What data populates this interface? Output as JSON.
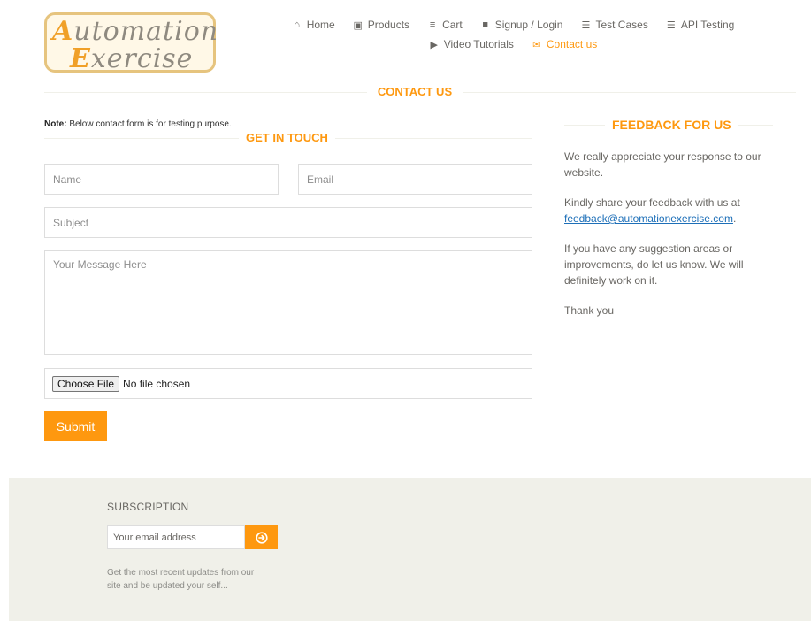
{
  "logo": {
    "line1_cap": "A",
    "line1_rest": "utomation",
    "line2_cap": "E",
    "line2_rest": "xercise"
  },
  "nav": {
    "row1": [
      {
        "icon": "home-icon",
        "glyph": "⌂",
        "label": "Home"
      },
      {
        "icon": "briefcase-icon",
        "glyph": "▣",
        "label": "Products"
      },
      {
        "icon": "cart-icon",
        "glyph": "≡",
        "label": "Cart"
      },
      {
        "icon": "lock-icon",
        "glyph": "■",
        "label": "Signup / Login"
      },
      {
        "icon": "list-icon",
        "glyph": "☰",
        "label": "Test Cases"
      },
      {
        "icon": "list-icon",
        "glyph": "☰",
        "label": "API Testing"
      }
    ],
    "row2": [
      {
        "icon": "video-icon",
        "glyph": "▶",
        "label": "Video Tutorials"
      },
      {
        "icon": "envelope-icon",
        "glyph": "✉",
        "label": "Contact us"
      }
    ]
  },
  "page": {
    "title": "CONTACT US"
  },
  "form": {
    "note_bold": "Note:",
    "note_text": " Below contact form is for testing purpose.",
    "title": "GET IN TOUCH",
    "name_placeholder": "Name",
    "email_placeholder": "Email",
    "subject_placeholder": "Subject",
    "message_placeholder": "Your Message Here",
    "file_button": "Choose File",
    "file_status": "No file chosen",
    "submit_label": "Submit"
  },
  "feedback": {
    "title": "FEEDBACK FOR US",
    "p1": "We really appreciate your response to our website.",
    "p2_text": "Kindly share your feedback with us at ",
    "p2_link": "feedback@automationexercise.com",
    "p2_end": ".",
    "p3": "If you have any suggestion areas or improvements, do let us know. We will definitely work on it.",
    "p4": "Thank you"
  },
  "footer": {
    "subscription_title": "SUBSCRIPTION",
    "email_placeholder": "Your email address",
    "subscribe_icon": "arrow-circle-right-icon",
    "note": "Get the most recent updates from our site and be updated your self..."
  },
  "colors": {
    "accent": "#fe980f",
    "footer_bg": "#f0f0e9",
    "link": "#1d6fb8"
  }
}
